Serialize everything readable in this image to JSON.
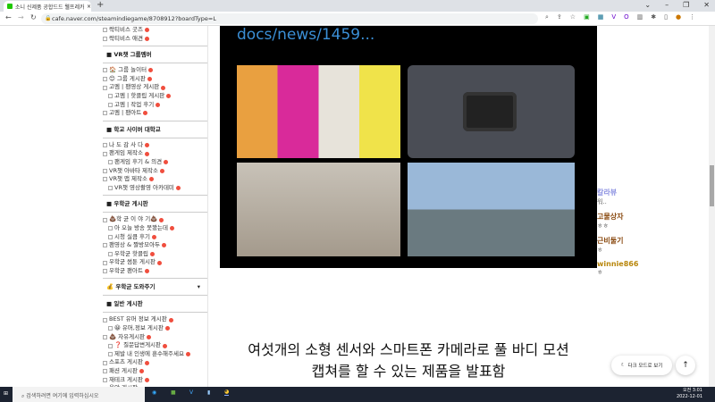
{
  "browser": {
    "tab_title": "소니 신제품 공합드드 웰프레카",
    "url": "cafe.naver.com/steamindiegame/8708912?boardType=L",
    "new_tab": "+",
    "close": "×"
  },
  "sidebar": {
    "top_items": [
      "락티비스 굿즈",
      "락티비스 애견"
    ],
    "sections": [
      {
        "title": "VR챗 그룹멤버",
        "items": [
          {
            "label": "🏠 그룹 놀이터",
            "sub": false
          },
          {
            "label": "😊 그룹 게시판",
            "sub": false
          },
          {
            "label": "고멤 | 팬영상 게시판",
            "sub": false
          },
          {
            "label": "고멤 | 핫클립 게시판",
            "sub": true
          },
          {
            "label": "고멤 | 작업 후기",
            "sub": true
          },
          {
            "label": "고멤 | 팬아트",
            "sub": false
          }
        ]
      },
      {
        "title": "학교 사이버 대학교",
        "items": [
          {
            "label": "나 도 감 사 다",
            "sub": false
          },
          {
            "label": "팬게임 제작소",
            "sub": false
          },
          {
            "label": "팬게임 후기 & 의견",
            "sub": true
          },
          {
            "label": "VR챗 아바타 제작소",
            "sub": false
          },
          {
            "label": "VR챗 맵 제작소",
            "sub": false
          },
          {
            "label": "VR챗 영상촬영 아카데미",
            "sub": true
          }
        ]
      },
      {
        "title": "우학균 게시판",
        "items": [
          {
            "label": "💩학 균 이 야 기💩",
            "sub": false
          },
          {
            "label": "아 오늘 방송 못봤는데",
            "sub": true
          },
          {
            "label": "시청 실큼 후기",
            "sub": true
          },
          {
            "label": "팬영상 & 짤방모아두",
            "sub": false
          },
          {
            "label": "우학균 핫클립",
            "sub": true
          },
          {
            "label": "우학균 썸툰 게시판",
            "sub": false
          },
          {
            "label": "우학균 팬아트",
            "sub": false
          }
        ]
      }
    ],
    "donate": "💰 우학균 도와주기",
    "general": {
      "title": "일반 게시판",
      "items": [
        {
          "label": "BEST 유머 정보 게시판",
          "sub": false
        },
        {
          "label": "😀 유머,정보 게시판",
          "sub": true
        },
        {
          "label": "💩 자유게시판",
          "sub": false
        },
        {
          "label": "❓ 질문답변게시판",
          "sub": true
        },
        {
          "label": "제발 내 인생에 훈수해주세요",
          "sub": true
        },
        {
          "label": "스포츠 게시판",
          "sub": false
        },
        {
          "label": "패션 게시판",
          "sub": false
        },
        {
          "label": "재테크 게시판",
          "sub": false
        },
        {
          "label": "음악 게시판",
          "sub": false
        },
        {
          "label": "리뷰게시판",
          "sub": false
        },
        {
          "label": "주식 공부 게시판",
          "sub": false
        }
      ]
    }
  },
  "post": {
    "link_text": "docs/news/1459...",
    "caption_line1": "여섯개의 소형 센서와 스마트폰 카메라로 풀 바디 모션",
    "caption_line2": "캡쳐를 할 수 있는 제품을 발표함"
  },
  "chat": [
    {
      "name": "칼라뷰",
      "msg": "워..",
      "color": "#8a8fe0"
    },
    {
      "name": "고물상자",
      "msg": "ㅎㅎ",
      "color": "#8a4a10"
    },
    {
      "name": "근비둘기",
      "msg": "ㅎ",
      "color": "#8a4a10"
    },
    {
      "name": "winnie866",
      "msg": "ㅎ",
      "color": "#b8860b"
    }
  ],
  "buttons": {
    "dark_mode": "다크 모드로 보기",
    "to_top": "↑"
  },
  "taskbar": {
    "search_placeholder": "검색하려면 여기에 입력하십시오",
    "time": "오전 3:01",
    "date": "2022-12-01"
  }
}
